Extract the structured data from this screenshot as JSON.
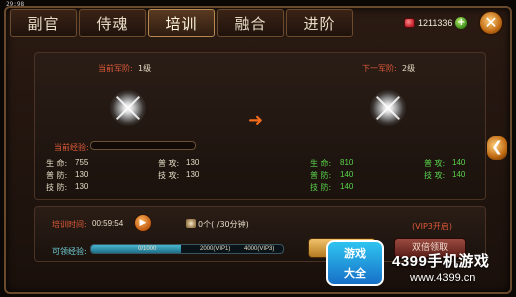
{
  "status_time": "29:98",
  "tabs": [
    {
      "label": "副官",
      "active": false
    },
    {
      "label": "侍魂",
      "active": false
    },
    {
      "label": "培训",
      "active": true
    },
    {
      "label": "融合",
      "active": false
    },
    {
      "label": "进阶",
      "active": false
    }
  ],
  "currency": {
    "gem_count": "1211336",
    "plus_label": "+"
  },
  "close_label": "✕",
  "current_rank": {
    "label": "当前军阶:",
    "value": "1级"
  },
  "next_rank": {
    "label": "下一军阶:",
    "value": "2级"
  },
  "exp_label": "当前经验:",
  "current_stats": [
    {
      "label": "生  命:",
      "value": "755"
    },
    {
      "label": "普  防:",
      "value": "130"
    },
    {
      "label": "技  防:",
      "value": "130"
    },
    {
      "label": "普  攻:",
      "value": "130"
    },
    {
      "label": "技  攻:",
      "value": "130"
    }
  ],
  "next_stats": [
    {
      "label": "生  命:",
      "value": "810"
    },
    {
      "label": "普  防:",
      "value": "140"
    },
    {
      "label": "技  防:",
      "value": "140"
    },
    {
      "label": "普  攻:",
      "value": "140"
    },
    {
      "label": "技  攻:",
      "value": "140"
    }
  ],
  "training": {
    "time_label": "培训时间:",
    "time_value": "00:59:54",
    "item_text": "0个(   /30分钟)",
    "vip_note": "(VIP3开启)"
  },
  "gain": {
    "label": "可领经验:",
    "bar_text_1": "0/1000",
    "bar_text_2": "2000(VIP1)",
    "bar_text_3": "4000(VIP3)",
    "fill_fraction": 0.47
  },
  "buttons": {
    "claim": "领取",
    "double_claim": "双倍领取"
  },
  "side_arrow": "❮",
  "watermark": {
    "logo_line1": "游戏",
    "logo_line2": "大全",
    "title": "4399手机游戏",
    "url": "www.4399.cn"
  }
}
